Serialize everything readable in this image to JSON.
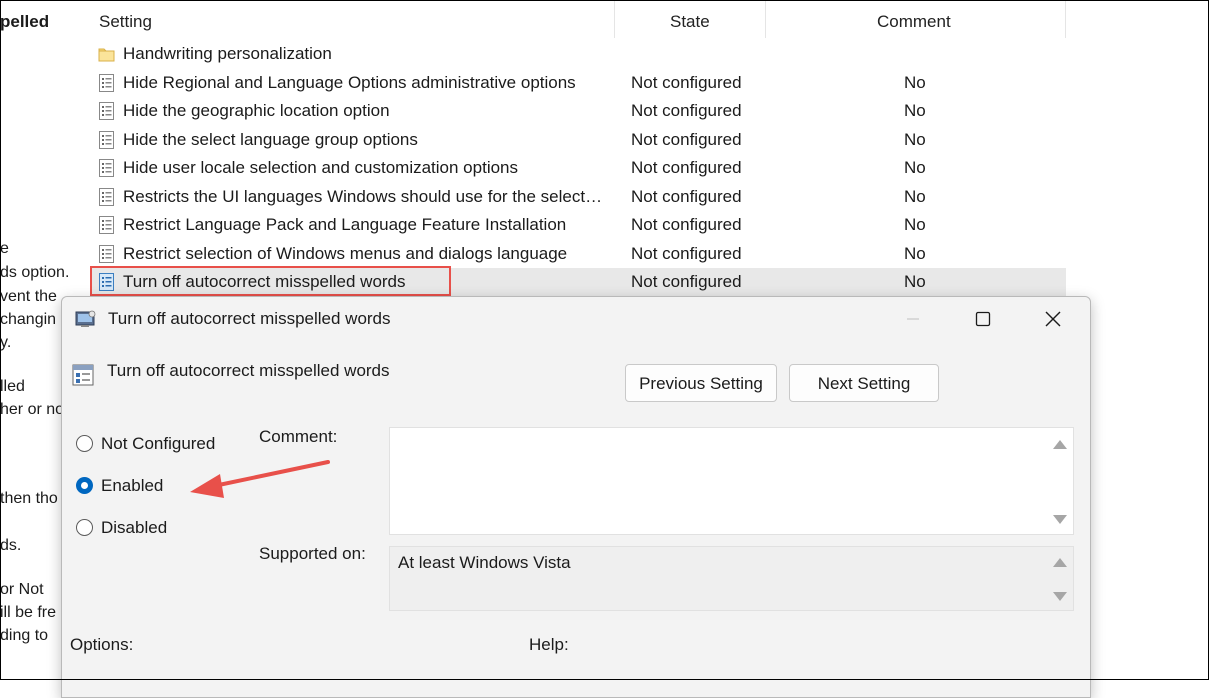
{
  "left_pane": {
    "title": "pelled",
    "lines": [
      "e",
      "ds option.",
      "vent the",
      "changin",
      "y.",
      "",
      "lled",
      "her or no",
      "",
      "then tho",
      "",
      "ds.",
      "",
      "or Not",
      "ill be fre",
      "ding to"
    ]
  },
  "list": {
    "columns": {
      "setting": "Setting",
      "state": "State",
      "comment": "Comment"
    },
    "rows": [
      {
        "name": "Handwriting personalization",
        "state": "",
        "comment": "",
        "icon": "folder-icon"
      },
      {
        "name": "Hide Regional and Language Options administrative options",
        "state": "Not configured",
        "comment": "No",
        "icon": "policy-icon"
      },
      {
        "name": "Hide the geographic location option",
        "state": "Not configured",
        "comment": "No",
        "icon": "policy-icon"
      },
      {
        "name": "Hide the select language group options",
        "state": "Not configured",
        "comment": "No",
        "icon": "policy-icon"
      },
      {
        "name": "Hide user locale selection and customization options",
        "state": "Not configured",
        "comment": "No",
        "icon": "policy-icon"
      },
      {
        "name": "Restricts the UI languages Windows should use for the select…",
        "state": "Not configured",
        "comment": "No",
        "icon": "policy-icon"
      },
      {
        "name": "Restrict Language Pack and Language Feature Installation",
        "state": "Not configured",
        "comment": "No",
        "icon": "policy-icon"
      },
      {
        "name": "Restrict selection of Windows menus and dialogs language",
        "state": "Not configured",
        "comment": "No",
        "icon": "policy-icon"
      },
      {
        "name": "Turn off autocorrect misspelled words",
        "state": "Not configured",
        "comment": "No",
        "icon": "policy-icon"
      }
    ]
  },
  "dialog": {
    "title": "Turn off autocorrect misspelled words",
    "policy_name": "Turn off autocorrect misspelled words",
    "buttons": {
      "previous": "Previous Setting",
      "next": "Next Setting"
    },
    "radio_options": [
      "Not Configured",
      "Enabled",
      "Disabled"
    ],
    "selected_option": "Enabled",
    "comment_label": "Comment:",
    "comment_value": "",
    "supported_label": "Supported on:",
    "supported_value": "At least Windows Vista",
    "options_label": "Options:",
    "help_label": "Help:"
  },
  "colors": {
    "highlight": "#e8504a",
    "accent": "#0067c0",
    "selected_row": "#e8e8e8"
  }
}
